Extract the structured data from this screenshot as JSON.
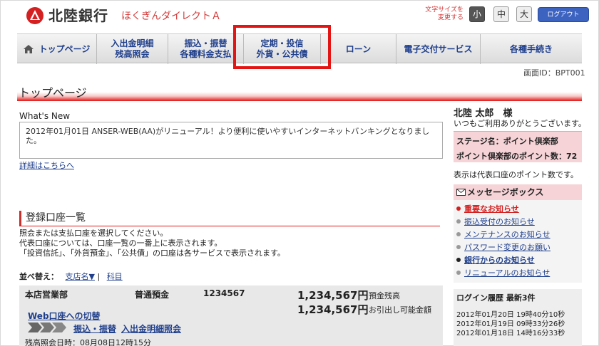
{
  "header": {
    "bank_name": "北陸銀行",
    "service_name": "ほくぎんダイレクトＡ",
    "font_size_label_1": "文字サイズを",
    "font_size_label_2": "変更する",
    "font_small": "小",
    "font_mid": "中",
    "font_large": "大",
    "logout_label": "ログアウト"
  },
  "nav": {
    "items": [
      {
        "line1": "トップページ",
        "line2": ""
      },
      {
        "line1": "入出金明細",
        "line2": "残高照会"
      },
      {
        "line1": "振込・振替",
        "line2": "各種料金支払"
      },
      {
        "line1": "定期・投信",
        "line2": "外貨・公共債"
      },
      {
        "line1": "ローン",
        "line2": ""
      },
      {
        "line1": "電子交付サービス",
        "line2": ""
      },
      {
        "line1": "各種手続き",
        "line2": ""
      }
    ]
  },
  "screen_id": "画面ID：BPT001",
  "page_title": "トップページ",
  "whatsnew": {
    "label": "What's New",
    "text": "2012年01月01日 ANSER-WEB(AA)がリニューアル！より便利に使いやすいインターネットバンキングとなりました。",
    "detail_link": "詳細はこちらへ"
  },
  "accounts": {
    "title": "登録口座一覧",
    "desc_1": "照会または支払口座を選択してください。",
    "desc_2": "代表口座については、口座一覧の一番上に表示されます。",
    "desc_3": "「投資信託」、「外貨預金」、「公共債」の口座は各サービスで表示されます。",
    "sort_label": "並べ替え：",
    "sort_branch": "支店名▼",
    "sort_sep": "|",
    "sort_subject": "科目",
    "row": {
      "branch": "本店営業部",
      "type": "普通預金",
      "number": "1234567",
      "balance": "1,234,567円",
      "balance_label": "預金残高",
      "available": "1,234,567円",
      "available_label": "お引出し可能金額",
      "web_switch": "Web口座への切替",
      "link_transfer": "振込・振替",
      "link_details": "入出金明細照会",
      "timestamp": "残高照会日時：08月08日12時15分"
    }
  },
  "user": {
    "name": "北陸 太郎　様",
    "greeting": "いつもご利用ありがとうございます。",
    "stage": "ステージ名：ポイント倶楽部",
    "points": "ポイント倶楽部のポイント数：72",
    "points_note": "表示は代表口座のポイント数です。"
  },
  "message_box": {
    "title": "メッセージボックス",
    "items": [
      {
        "label": "重要なお知らせ",
        "color": "#d42020",
        "bold": true
      },
      {
        "label": "振込受付のお知らせ",
        "color": "#999999",
        "bold": false
      },
      {
        "label": "メンテナンスのお知らせ",
        "color": "#999999",
        "bold": false
      },
      {
        "label": "パスワード変更のお願い",
        "color": "#999999",
        "bold": false
      },
      {
        "label": "銀行からのお知らせ",
        "color": "#222222",
        "bold": true
      },
      {
        "label": "リニューアルのお知らせ",
        "color": "#999999",
        "bold": false
      }
    ]
  },
  "login_history": {
    "title": "ログイン履歴 最新3件",
    "entries": [
      "2012年01月20日 19時40分10秒",
      "2012年01月19日 09時33分26秒",
      "2012年01月18日 14時16分33秒"
    ]
  },
  "colors": {
    "accent_red": "#e31414",
    "link_blue": "#1f3f8c"
  }
}
